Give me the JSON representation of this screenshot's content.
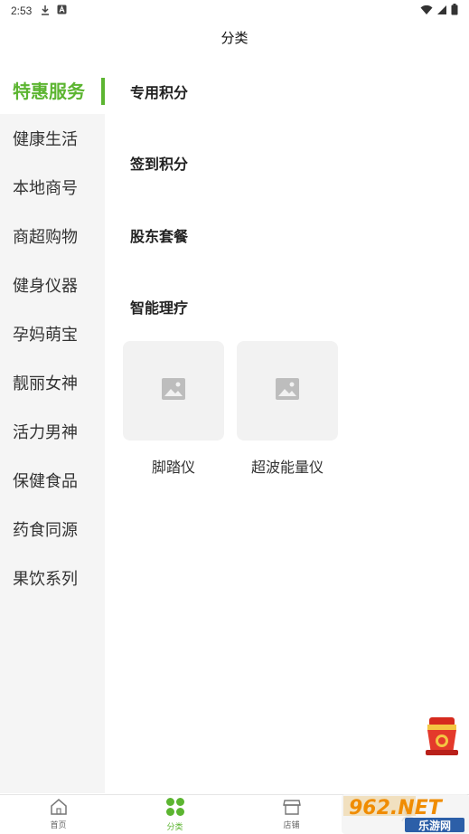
{
  "status_bar": {
    "time": "2:53",
    "icons": [
      "download-icon",
      "a-box-icon",
      "wifi-icon",
      "signal-icon",
      "battery-icon"
    ]
  },
  "header": {
    "title": "分类"
  },
  "sidebar": {
    "items": [
      {
        "label": "特惠服务",
        "active": true
      },
      {
        "label": "健康生活"
      },
      {
        "label": "本地商号"
      },
      {
        "label": "商超购物"
      },
      {
        "label": "健身仪器"
      },
      {
        "label": "孕妈萌宝"
      },
      {
        "label": "靓丽女神"
      },
      {
        "label": "活力男神"
      },
      {
        "label": "保健食品"
      },
      {
        "label": "药食同源"
      },
      {
        "label": "果饮系列"
      }
    ]
  },
  "main": {
    "sections": [
      {
        "title": "专用积分"
      },
      {
        "title": "签到积分"
      },
      {
        "title": "股东套餐"
      },
      {
        "title": "智能理疗",
        "products": [
          {
            "label": "脚踏仪",
            "icon": "image-placeholder-icon"
          },
          {
            "label": "超波能量仪",
            "icon": "image-placeholder-icon"
          }
        ]
      }
    ]
  },
  "floating_badge": {
    "icon": "red-envelope-icon"
  },
  "bottom_nav": {
    "items": [
      {
        "label": "首页",
        "icon": "home-icon"
      },
      {
        "label": "分类",
        "icon": "category-grid-icon",
        "active": true
      },
      {
        "label": "店铺",
        "icon": "store-icon"
      },
      {
        "label": "",
        "icon": "user-icon"
      }
    ]
  },
  "watermark": {
    "text": "962.NET",
    "subtext": "乐游网"
  },
  "colors": {
    "accent": "#5cb531",
    "sidebar_bg": "#f5f5f5",
    "placeholder_bg": "#f2f2f2"
  }
}
